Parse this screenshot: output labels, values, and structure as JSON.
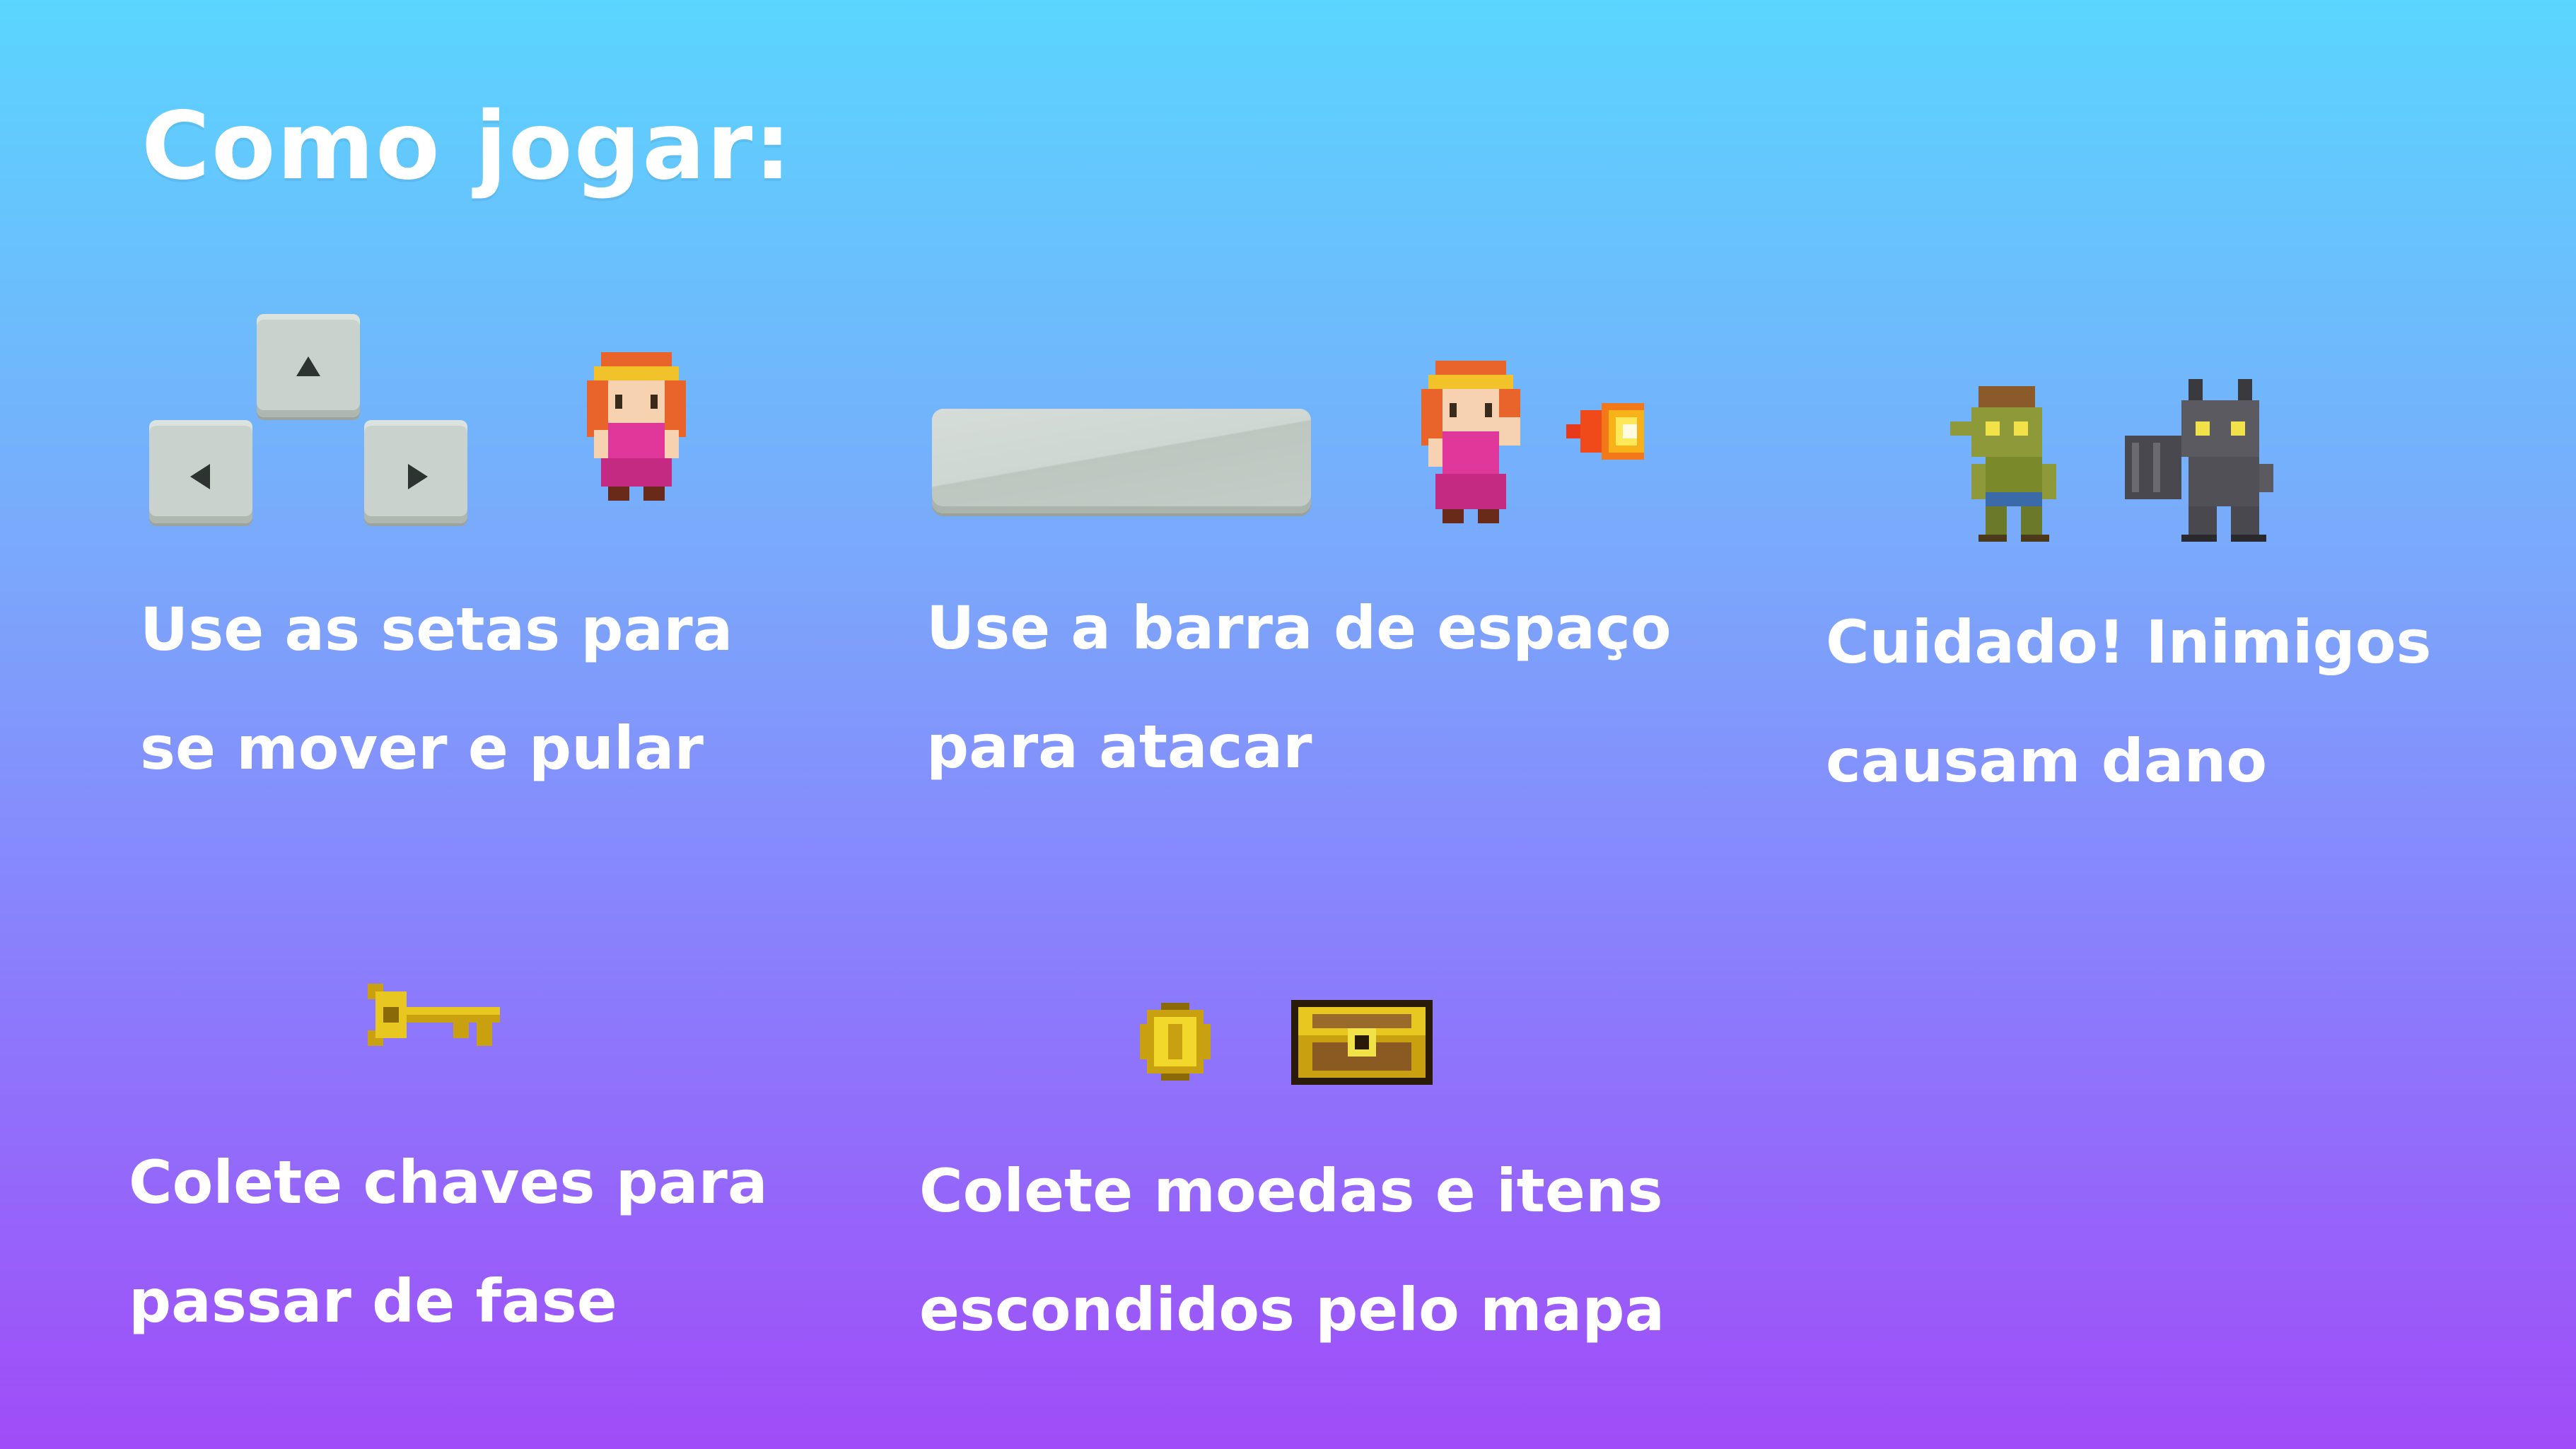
{
  "title": "Como jogar:",
  "colors": {
    "gradient_top": "#5ad5fe",
    "gradient_bottom": "#a04cf8",
    "text": "#ffffff",
    "key": "#c9d2cc",
    "gold": "#e8c820",
    "princess_dress": "#e0389a",
    "princess_hair": "#e8642a"
  },
  "sections": {
    "move": {
      "line1": "Use as setas para",
      "line2": "se mover e pular",
      "icons": [
        "arrow-up-key",
        "arrow-left-key",
        "arrow-right-key",
        "princess-walking-sprite"
      ]
    },
    "attack": {
      "line1": "Use a barra de espaço",
      "line2": "para atacar",
      "icons": [
        "spacebar-key",
        "princess-casting-sprite",
        "fireball-sprite"
      ]
    },
    "enemies": {
      "line1": "Cuidado! Inimigos",
      "line2": "causam dano",
      "icons": [
        "goblin-enemy-sprite",
        "gargoyle-enemy-sprite"
      ]
    },
    "keys": {
      "line1": "Colete chaves para",
      "line2": "passar de fase",
      "icons": [
        "golden-key-sprite"
      ]
    },
    "coins": {
      "line1": "Colete moedas e itens",
      "line2": "escondidos pelo mapa",
      "icons": [
        "gold-coin-sprite",
        "treasure-chest-sprite"
      ]
    }
  }
}
